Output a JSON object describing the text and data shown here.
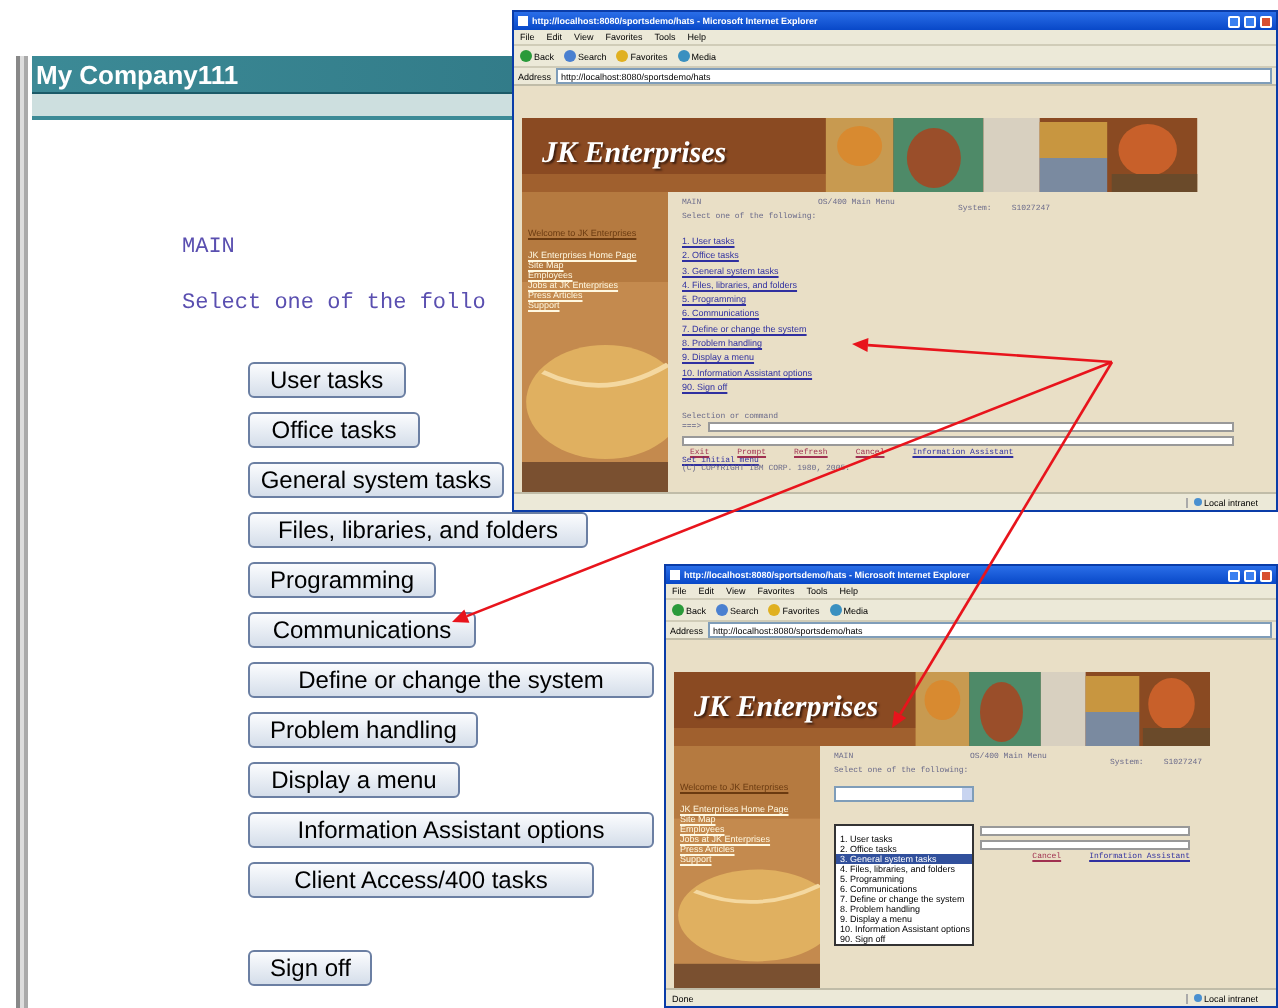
{
  "page": {
    "title": "My Company111",
    "heading": "MAIN",
    "instruction": "Select one of the follo",
    "buttons": [
      "User tasks",
      "Office tasks",
      "General system tasks",
      "Files, libraries, and folders",
      "Programming",
      "Communications",
      "Define or change the system",
      "Problem handling",
      "Display a menu",
      "Information Assistant options",
      "Client Access/400 tasks",
      "Sign off"
    ]
  },
  "browsers": [
    {
      "title": "http://localhost:8080/sportsdemo/hats - Microsoft Internet Explorer",
      "menu": [
        "File",
        "Edit",
        "View",
        "Favorites",
        "Tools",
        "Help"
      ],
      "toolbar": [
        "Back",
        "Search",
        "Favorites",
        "Media"
      ],
      "address_label": "Address",
      "address": "http://localhost:8080/sportsdemo/hats",
      "banner": "JK Enterprises",
      "sidebar": {
        "heading": "Welcome to JK Enterprises",
        "links": [
          "JK Enterprises Home Page",
          "Site Map",
          "Employees",
          "Jobs at JK Enterprises",
          "Press Articles",
          "Support"
        ]
      },
      "screen": {
        "name": "MAIN",
        "menu_title": "OS/400 Main Menu",
        "system_label": "System:",
        "system": "S1027247",
        "prompt": "Select one of the following:",
        "options": [
          "1. User tasks",
          "2. Office tasks",
          "3. General system tasks",
          "4. Files, libraries, and folders",
          "5. Programming",
          "6. Communications",
          "7. Define or change the system",
          "8. Problem handling",
          "9. Display a menu",
          "10. Information Assistant options",
          "90. Sign off"
        ],
        "command_label": "Selection or command",
        "command_prompt": "===>",
        "function_keys": [
          "Exit",
          "Prompt",
          "Refresh",
          "Cancel",
          "Information Assistant"
        ],
        "footer_link": "Set initial menu",
        "copyright": "(C) COPYRIGHT IBM CORP. 1980, 2005."
      },
      "zone": "Local intranet"
    },
    {
      "title": "http://localhost:8080/sportsdemo/hats - Microsoft Internet Explorer",
      "menu": [
        "File",
        "Edit",
        "View",
        "Favorites",
        "Tools",
        "Help"
      ],
      "toolbar": [
        "Back",
        "Search",
        "Favorites",
        "Media"
      ],
      "address_label": "Address",
      "address": "http://localhost:8080/sportsdemo/hats",
      "banner": "JK Enterprises",
      "sidebar": {
        "heading": "Welcome to JK Enterprises",
        "links": [
          "JK Enterprises Home Page",
          "Site Map",
          "Employees",
          "Jobs at JK Enterprises",
          "Press Articles",
          "Support"
        ]
      },
      "screen": {
        "name": "MAIN",
        "menu_title": "OS/400 Main Menu",
        "system_label": "System:",
        "system": "S1027247",
        "prompt": "Select one of the following:",
        "dropdown": [
          {
            "label": "1. User tasks",
            "selected": false
          },
          {
            "label": "2. Office tasks",
            "selected": false
          },
          {
            "label": "3. General system tasks",
            "selected": true
          },
          {
            "label": "4. Files, libraries, and folders",
            "selected": false
          },
          {
            "label": "5. Programming",
            "selected": false
          },
          {
            "label": "6. Communications",
            "selected": false
          },
          {
            "label": "7. Define or change the system",
            "selected": false
          },
          {
            "label": "8. Problem handling",
            "selected": false
          },
          {
            "label": "9. Display a menu",
            "selected": false
          },
          {
            "label": "10. Information Assistant options",
            "selected": false
          },
          {
            "label": "90. Sign off",
            "selected": false
          }
        ],
        "function_keys": [
          "Cancel",
          "Information Assistant"
        ]
      },
      "status": "Done",
      "zone": "Local intranet"
    }
  ]
}
